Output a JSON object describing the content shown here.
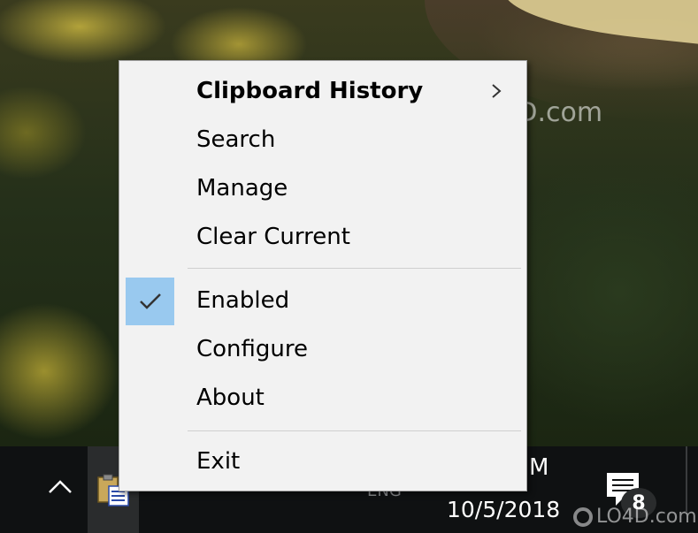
{
  "menu": {
    "items": [
      {
        "label": "Clipboard History",
        "bold": true,
        "has_submenu": true
      },
      {
        "label": "Search"
      },
      {
        "label": "Manage"
      },
      {
        "label": "Clear Current"
      },
      {
        "label": "Enabled",
        "checked": true
      },
      {
        "label": "Configure"
      },
      {
        "label": "About"
      },
      {
        "label": "Exit"
      }
    ],
    "check_color": "#99c9ef"
  },
  "taskbar": {
    "time_fragment": "M",
    "date": "10/5/2018",
    "tray_language_fragment": "ENG",
    "notification_count": "8"
  },
  "watermark": {
    "text": "LO4D.com"
  },
  "icons": {
    "tray_chevron": "chevron-up-icon",
    "tray_app": "clipboard-app-icon",
    "submenu": "chevron-right-icon",
    "check": "checkmark-icon",
    "notifications": "action-center-icon"
  }
}
